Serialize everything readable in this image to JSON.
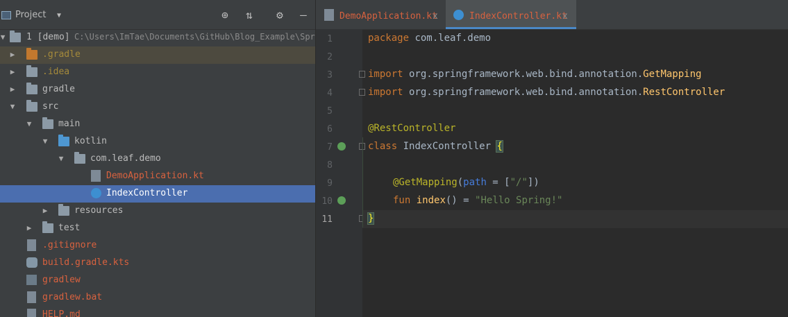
{
  "project_panel": {
    "title": "Project",
    "tree": [
      {
        "label": "1 [demo]",
        "path": "C:\\Users\\ImTae\\Documents\\GitHub\\Blog_Example\\Spri",
        "icon": "module-folder-icon"
      },
      {
        "label": ".gradle",
        "icon": "folder-icon"
      },
      {
        "label": ".idea",
        "icon": "folder-icon"
      },
      {
        "label": "gradle",
        "icon": "folder-icon"
      },
      {
        "label": "src",
        "icon": "folder-icon"
      },
      {
        "label": "main",
        "icon": "source-folder-icon"
      },
      {
        "label": "kotlin",
        "icon": "folder-icon"
      },
      {
        "label": "com.leaf.demo",
        "icon": "package-icon"
      },
      {
        "label": "DemoApplication.kt",
        "icon": "kotlin-file-icon"
      },
      {
        "label": "IndexController",
        "icon": "kotlin-class-icon"
      },
      {
        "label": "resources",
        "icon": "resources-folder-icon"
      },
      {
        "label": "test",
        "icon": "test-folder-icon"
      },
      {
        "label": ".gitignore",
        "icon": "gitignore-file-icon"
      },
      {
        "label": "build.gradle.kts",
        "icon": "gradle-file-icon"
      },
      {
        "label": "gradlew",
        "icon": "terminal-file-icon"
      },
      {
        "label": "gradlew.bat",
        "icon": "text-file-icon"
      },
      {
        "label": "HELP.md",
        "icon": "markdown-file-icon"
      }
    ]
  },
  "editor": {
    "tabs": [
      {
        "label": "DemoApplication.kt",
        "close": "x"
      },
      {
        "label": "IndexController.kt",
        "close": "x"
      }
    ],
    "line_numbers": [
      "1",
      "2",
      "3",
      "4",
      "5",
      "6",
      "7",
      "8",
      "9",
      "10",
      "11"
    ]
  },
  "code": {
    "l1_kw": "package",
    "l1_rest": " com.leaf.demo",
    "l3_kw": "import",
    "l3_pkg": " org.springframework.web.bind.annotation.",
    "l3_cls": "GetMapping",
    "l4_kw": "import",
    "l4_pkg": " org.springframework.web.bind.annotation.",
    "l4_cls": "RestController",
    "l6_ann": "@RestController",
    "l7_kw": "class",
    "l7_name": " IndexController ",
    "l7_brace": "{",
    "l9_ann": "@GetMapping",
    "l9_open": "(",
    "l9_param": "path",
    "l9_eq": " = [",
    "l9_str": "\"/\"",
    "l9_close": "])",
    "l10_kw": "fun",
    "l10_fn": " index",
    "l10_mid": "() = ",
    "l10_str": "\"Hello Spring!\"",
    "l11_brace": "}"
  },
  "colors": {
    "keyword": "#cc7832",
    "annotation": "#bbb529",
    "string": "#6a8759",
    "function": "#ffc66d",
    "selection": "#4b6eaf",
    "red_file": "#d9623f",
    "tab_accent": "#4a88c7"
  }
}
